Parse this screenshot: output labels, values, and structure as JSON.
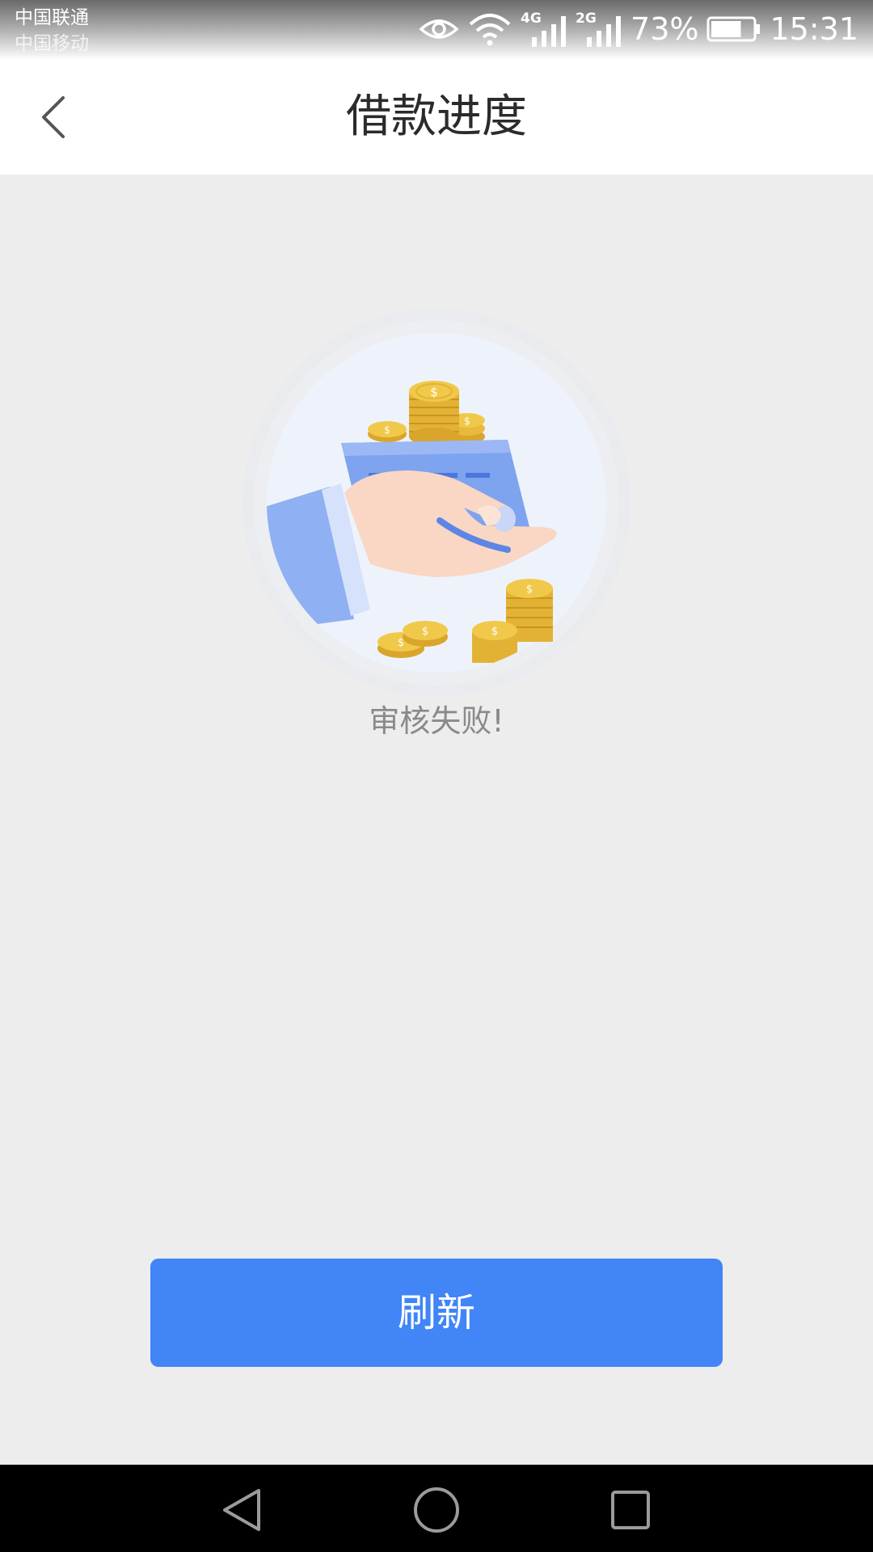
{
  "status_bar": {
    "carrier_1": "中国联通",
    "carrier_2": "中国移动",
    "network_1": "4G",
    "network_2": "2G",
    "battery": "73%",
    "battery_level": 0.73,
    "time": "15:31"
  },
  "header": {
    "title": "借款进度"
  },
  "main": {
    "status_text": "审核失败!"
  },
  "actions": {
    "refresh_label": "刷新"
  },
  "colors": {
    "accent": "#4185f7",
    "background": "#ededed",
    "coin": "#e8b93a"
  },
  "icons": {
    "back": "chevron-left-icon",
    "nav_back": "triangle-back-icon",
    "nav_home": "circle-home-icon",
    "nav_recent": "square-recent-icon"
  }
}
